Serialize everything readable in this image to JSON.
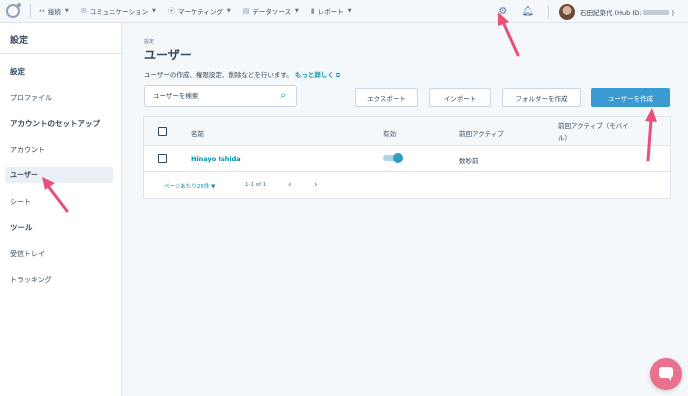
{
  "topnav": {
    "items": [
      {
        "label": "接続",
        "icon": "connect-icon",
        "glyph": "↔"
      },
      {
        "label": "コミュニケーション",
        "icon": "chat-icon",
        "glyph": "✉"
      },
      {
        "label": "マーケティング",
        "icon": "broadcast-icon",
        "glyph": "⦿"
      },
      {
        "label": "データソース",
        "icon": "database-icon",
        "glyph": "▤"
      },
      {
        "label": "レポート",
        "icon": "chart-icon",
        "glyph": "▮"
      }
    ],
    "user_name": "石田紀菜代 (Hub ID:",
    "user_name_end": ")"
  },
  "sidebar": {
    "title": "設定",
    "sections": [
      {
        "title": "設定",
        "items": [
          "プロファイル"
        ]
      },
      {
        "title": "アカウントのセットアップ",
        "items": [
          "アカウント",
          "ユーザー",
          "シート"
        ]
      },
      {
        "title": "ツール",
        "items": [
          "受信トレイ",
          "トラッキング"
        ]
      }
    ]
  },
  "main": {
    "breadcrumb": "設定",
    "title": "ユーザー",
    "description": "ユーザーの作成、権限設定、削除などを行います。",
    "learn_more": "もっと詳しく",
    "search": {
      "placeholder": "ユーザーを検索"
    },
    "buttons": {
      "export": "エクスポート",
      "import": "インポート",
      "create_folder": "フォルダーを作成",
      "create_user": "ユーザーを作成"
    },
    "table": {
      "headers": [
        "名前",
        "有効",
        "前回アクティブ",
        "前回アクティブ（モバイ",
        "ル）"
      ],
      "rows": [
        {
          "name": "Hinayo Ishida",
          "active": true,
          "last_active": "数秒前",
          "last_active_mobile": ""
        }
      ],
      "pager": {
        "per_page": "ページあたり25件",
        "range": "1-1 of 1"
      }
    }
  },
  "colors": {
    "accent": "#0091ae",
    "primary_button": "#3a9bd3",
    "arrow": "#e8507a"
  }
}
